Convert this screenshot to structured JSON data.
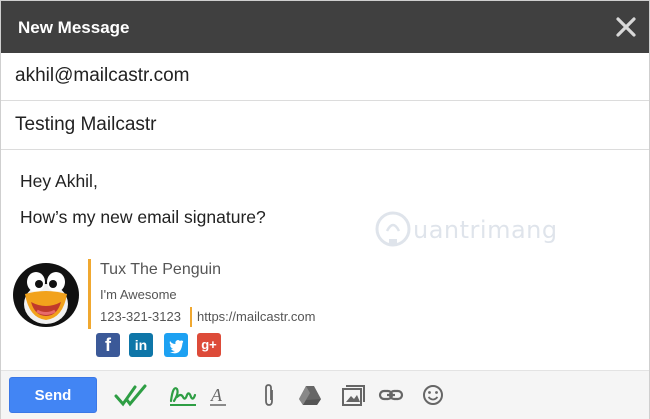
{
  "window": {
    "title": "New Message"
  },
  "to": {
    "value": "akhil@mailcastr.com"
  },
  "subject": {
    "value": "Testing Mailcastr"
  },
  "body": {
    "greeting": "Hey Akhil,",
    "message": "How’s my new email signature?"
  },
  "signature": {
    "name": "Tux The Penguin",
    "tagline": "I'm Awesome",
    "phone": "123-321-3123",
    "url": "https://mailcastr.com",
    "social": [
      {
        "label": "f",
        "icon": "facebook-icon",
        "color": "#3b5998"
      },
      {
        "label": "in",
        "icon": "linkedin-icon",
        "color": "#0e76a8"
      },
      {
        "label": "t",
        "icon": "twitter-icon",
        "color": "#1da1f2"
      },
      {
        "label": "g+",
        "icon": "google-plus-icon",
        "color": "#dd4b39"
      }
    ],
    "accent_color": "#f0a830"
  },
  "watermark": {
    "text": "uantrimang"
  },
  "footer": {
    "send_label": "Send",
    "send_color": "#4285f4",
    "tools": [
      "mailcastr-track-icon",
      "signature-icon",
      "formatting-icon",
      "attach-icon",
      "drive-icon",
      "photo-icon",
      "link-icon",
      "emoji-icon"
    ]
  }
}
